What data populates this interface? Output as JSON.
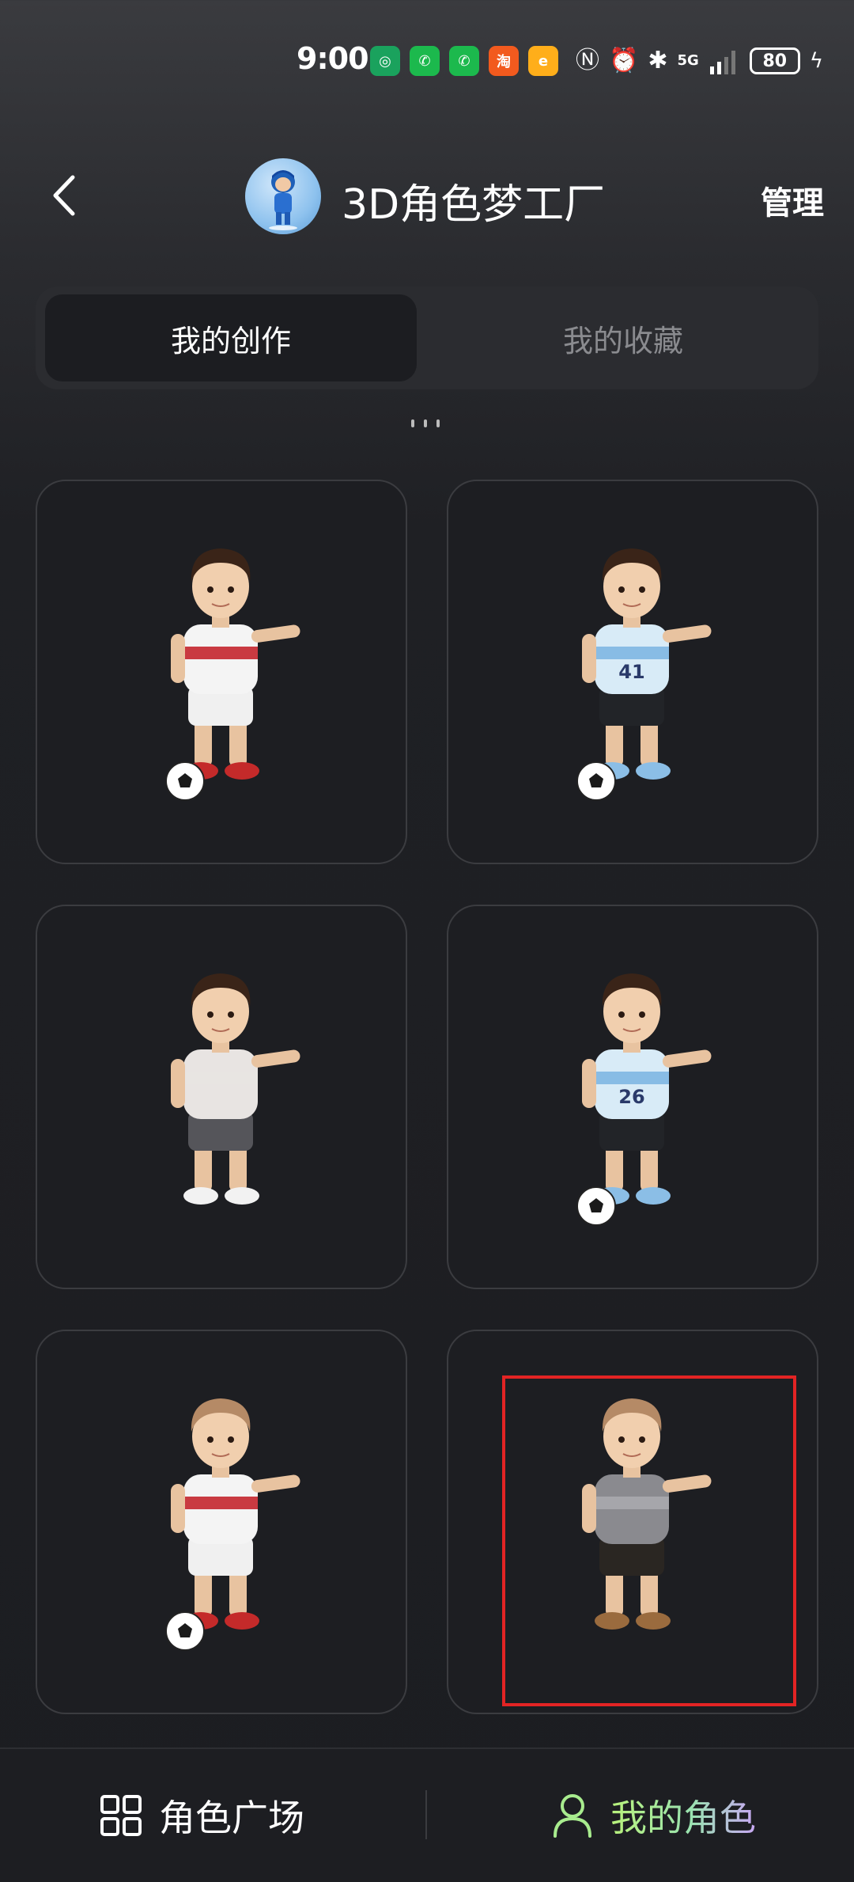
{
  "status_bar": {
    "time": "9:00",
    "network": "5G",
    "battery": "80",
    "app_icons": [
      {
        "name": "green-swirl-app-icon",
        "color": "#1aa25d",
        "glyph": "◎"
      },
      {
        "name": "wechat-icon",
        "color": "#1cb94d",
        "glyph": "✆"
      },
      {
        "name": "wechat-icon-2",
        "color": "#1cb94d",
        "glyph": "✆"
      },
      {
        "name": "taobao-deals-app-icon",
        "color": "#f25a1e",
        "glyph": "淘"
      },
      {
        "name": "orange-app-icon",
        "color": "#ffae1a",
        "glyph": "e"
      }
    ],
    "indicator_glyphs": [
      {
        "name": "nfc-icon",
        "glyph": "Ⓝ"
      },
      {
        "name": "alarm-icon",
        "glyph": "⏰"
      },
      {
        "name": "bluetooth-icon",
        "glyph": "✱"
      }
    ]
  },
  "header": {
    "title": "3D角色梦工厂",
    "manage_label": "管理"
  },
  "tabs": [
    {
      "label": "我的创作",
      "active": true
    },
    {
      "label": "我的收藏",
      "active": false
    }
  ],
  "characters": [
    {
      "name": "character-card-white-red-soccer",
      "hair": "#3a2418",
      "shirt": "#f4f4f4",
      "stripe": "#c4262e",
      "shorts": "#f0f0f0",
      "shoes": "#c42a2a",
      "ball": true,
      "number": ""
    },
    {
      "name": "character-card-blue-white-41",
      "hair": "#3a2418",
      "shirt": "#d8ebf7",
      "stripe": "#7fb7e2",
      "shorts": "#222428",
      "shoes": "#8bbee6",
      "ball": true,
      "number": "41"
    },
    {
      "name": "character-card-microphone",
      "hair": "#3a2418",
      "shirt": "#e8e4e2",
      "stripe": "#e8e4e2",
      "shorts": "#55555a",
      "shoes": "#f2f2f2",
      "ball": false,
      "number": ""
    },
    {
      "name": "character-card-blue-white-26",
      "hair": "#3a2418",
      "shirt": "#d8ebf7",
      "stripe": "#7fb7e2",
      "shorts": "#222428",
      "shoes": "#8bbee6",
      "ball": true,
      "number": "26"
    },
    {
      "name": "character-card-blonde-soccer",
      "hair": "#b58a66",
      "shirt": "#f4f4f4",
      "stripe": "#c4262e",
      "shorts": "#f0f0f0",
      "shoes": "#c42a2a",
      "ball": true,
      "number": ""
    },
    {
      "name": "character-card-blonde-armor",
      "hair": "#b58a66",
      "shirt": "#8a8a8f",
      "stripe": "#a9a9ae",
      "shorts": "#2a2622",
      "shoes": "#9a6b3e",
      "ball": false,
      "number": ""
    }
  ],
  "bottom_nav": {
    "square_label": "角色广场",
    "mine_label": "我的角色",
    "mine_icon_color": "#a8ec8e"
  }
}
